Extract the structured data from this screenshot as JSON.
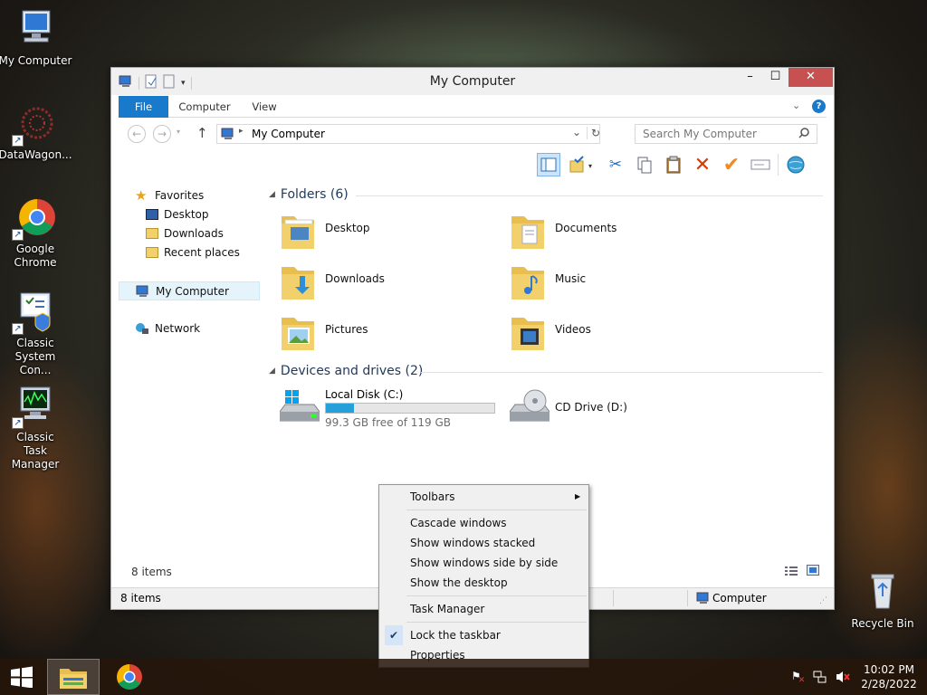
{
  "desktop": {
    "icons": [
      {
        "label": "My Computer",
        "icon": "computer-icon"
      },
      {
        "label": "DataWagon...",
        "icon": "datawagon-icon"
      },
      {
        "label": "Google Chrome",
        "icon": "chrome-icon"
      },
      {
        "label": "Classic System Con...",
        "icon": "control-panel-icon"
      },
      {
        "label": "Classic Task Manager",
        "icon": "task-manager-icon"
      }
    ],
    "recycle_bin": {
      "label": "Recycle Bin",
      "icon": "recycle-bin-icon"
    }
  },
  "window": {
    "title": "My Computer",
    "ribbon_tabs": [
      "File",
      "Computer",
      "View"
    ],
    "address": "My Computer",
    "search_placeholder": "Search My Computer",
    "nav": {
      "favorites": "Favorites",
      "items": [
        "Desktop",
        "Downloads",
        "Recent places"
      ],
      "my_computer": "My Computer",
      "network": "Network"
    },
    "groups": {
      "folders": "Folders (6)",
      "devices": "Devices and drives (2)"
    },
    "folders": [
      "Desktop",
      "Documents",
      "Downloads",
      "Music",
      "Pictures",
      "Videos"
    ],
    "drives": [
      {
        "name": "Local Disk (C:)",
        "free": "99.3 GB free of 119 GB",
        "used_fraction": 0.166
      },
      {
        "name": "CD Drive (D:)"
      }
    ],
    "item_count": "8 items",
    "status": {
      "count": "8 items",
      "location": "Computer"
    }
  },
  "context_menu": {
    "items": [
      "Toolbars",
      "Cascade windows",
      "Show windows stacked",
      "Show windows side by side",
      "Show the desktop",
      "Task Manager",
      "Lock the taskbar",
      "Properties"
    ]
  },
  "taskbar": {
    "time": "10:02 PM",
    "date": "2/28/2022"
  },
  "colors": {
    "accent": "#1979ca",
    "folder": "#f2d06b",
    "progress": "#26a0da",
    "close": "#c75050"
  }
}
